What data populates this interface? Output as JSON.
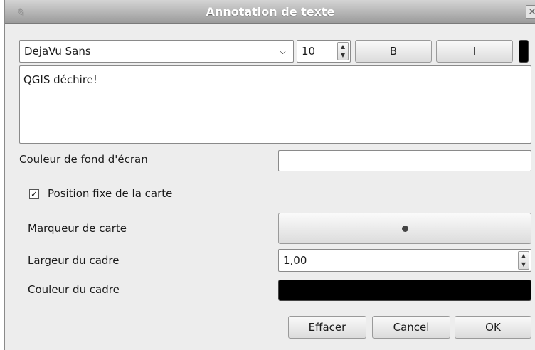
{
  "window": {
    "title": "Annotation de texte"
  },
  "font": {
    "family": "DejaVu Sans",
    "size": "10"
  },
  "style_buttons": {
    "bold_label": "B",
    "italic_label": "I"
  },
  "text": {
    "content": "QGIS déchire!"
  },
  "background_color": {
    "label": "Couleur de fond d'écran",
    "color": "#ffffff"
  },
  "fixed_position": {
    "label": "Position fixe de la carte",
    "checked": true
  },
  "map_marker": {
    "label": "Marqueur de carte"
  },
  "frame_width": {
    "label": "Largeur du cadre",
    "value": "1,00"
  },
  "frame_color": {
    "label": "Couleur du cadre",
    "color": "#000000"
  },
  "buttons": {
    "delete": "Effacer",
    "cancel_mnemonic": "C",
    "cancel_rest": "ancel",
    "ok_mnemonic": "O",
    "ok_rest": "K"
  }
}
